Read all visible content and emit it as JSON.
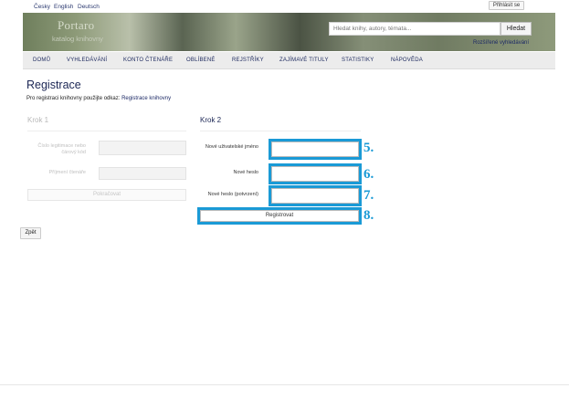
{
  "languages": [
    "Česky",
    "English",
    "Deutsch"
  ],
  "header": {
    "login_label": "Přihlásit se"
  },
  "banner": {
    "brand_name": "Portaro",
    "brand_sub": "katalog knihovny",
    "search_placeholder": "Hledat knihy, autory, témata...",
    "search_button": "Hledat",
    "advanced_search": "Rozšířené vyhledávání"
  },
  "nav": [
    "DOMŮ",
    "VYHLEDÁVÁNÍ",
    "KONTO ČTENÁŘE",
    "OBLÍBENÉ",
    "REJSTŘÍKY",
    "ZAJÍMAVÉ TITULY",
    "STATISTIKY",
    "NÁPOVĚDA"
  ],
  "page": {
    "title": "Registrace",
    "intro_text": "Pro registraci knihovny použijte odkaz: ",
    "intro_link": "Registrace knihovny"
  },
  "step1": {
    "heading": "Krok 1",
    "card_label": "Číslo legitimace nebo čárový kód",
    "surname_label": "Příjmení čtenáře",
    "continue_button": "Pokračovat"
  },
  "step2": {
    "heading": "Krok 2",
    "username_label": "Nové uživatelské jméno",
    "password_label": "Nové heslo",
    "password_confirm_label": "Nové heslo (potvrzení)",
    "register_button": "Registrovat"
  },
  "annotations": [
    "5.",
    "6.",
    "7.",
    "8."
  ],
  "back_button": "Zpět",
  "colors": {
    "accent": "#1a9ad6",
    "nav_text": "#1f2b60",
    "title": "#1c2755"
  }
}
